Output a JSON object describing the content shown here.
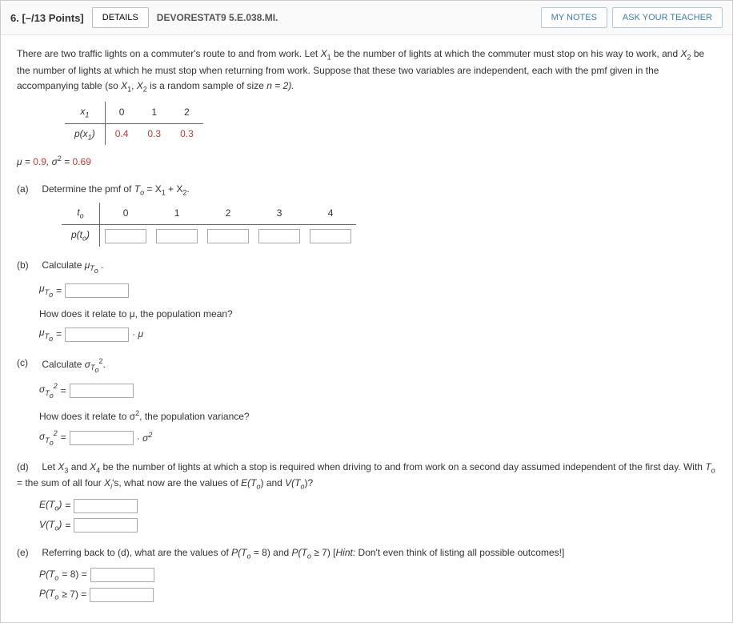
{
  "header": {
    "number_points": "6. [–/13 Points]",
    "details_btn": "DETAILS",
    "assignment": "DEVORESTAT9 5.E.038.MI.",
    "my_notes_btn": "MY NOTES",
    "ask_teacher_btn": "ASK YOUR TEACHER"
  },
  "intro": {
    "line1a": "There are two traffic lights on a commuter's route to and from work. Let ",
    "x1": "X",
    "line1b": " be the number of lights at which the commuter must stop on his way to work, and ",
    "x2": "X",
    "line1c": " be the number of lights at which he must stop when returning from work. Suppose that these two variables are independent, each with the pmf given in the accompanying table (so ",
    "line1d": " is a random sample of size ",
    "n_eq": "n = 2)."
  },
  "pmf_table": {
    "row1_label": "x",
    "row1_vals": [
      "0",
      "1",
      "2"
    ],
    "row2_label": "p(x",
    "row2_vals": [
      "0.4",
      "0.3",
      "0.3"
    ]
  },
  "params": {
    "mu_eq": "μ = ",
    "mu_val": "0.9",
    "sigma2_eq": ", σ",
    "sigma2_val": "0.69",
    "eq_sign": " = "
  },
  "parts": {
    "a": {
      "label": "(a)",
      "text": "Determine the pmf of ",
      "To": "T",
      "eq": " = X",
      "plus": " + X",
      "dot": ".",
      "t_label": "t",
      "t_vals": [
        "0",
        "1",
        "2",
        "3",
        "4"
      ],
      "p_label": "p(t",
      "p_close": ")"
    },
    "b": {
      "label": "(b)",
      "text": "Calculate ",
      "mu_to": "μ",
      "eq": " = ",
      "relate_q": "How does it relate to μ, the population mean?",
      "times_mu": " · μ"
    },
    "c": {
      "label": "(c)",
      "text": "Calculate ",
      "sigma_to": "σ",
      "sq": "2",
      "dot": ".",
      "eq": " = ",
      "relate_q": "How does it relate to σ",
      "relate_q2": ", the population variance?",
      "times_sigma2": " · σ"
    },
    "d": {
      "label": "(d)",
      "text1": "Let ",
      "text2": " and ",
      "text3": " be the number of lights at which a stop is required when driving to and from work on a second day assumed independent of the first day. With ",
      "text4": " = the sum of all four ",
      "text5": "'s, what now are the values of ",
      "ET": "E(T",
      "and": ") and ",
      "VT": "V(T",
      "q": ")?",
      "eq": " = "
    },
    "e": {
      "label": "(e)",
      "text1": "Referring back to (d), what are the values of ",
      "PT8": "P(T",
      "eq8": " = 8) and ",
      "PT7": "P(T",
      "ge7": " ≥ 7) [",
      "hint_label": "Hint:",
      "hint_text": " Don't even think of listing all possible outcomes!]",
      "p8_label": "P(T",
      "p8_eq": " = 8)  =  ",
      "p7_label": "P(T",
      "p7_eq": " ≥ 7)  =  "
    }
  }
}
